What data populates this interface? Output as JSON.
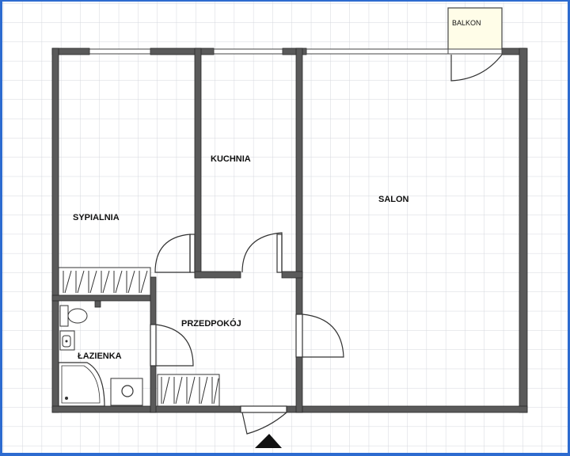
{
  "plan": {
    "rooms": {
      "balkon": "BALKON",
      "kuchnia": "KUCHNIA",
      "salon": "SALON",
      "sypialnia": "SYPIALNIA",
      "przedpokoj": "PRZEDPOKÓJ",
      "lazienka": "ŁAZIENKA"
    },
    "colors": {
      "grid": "#d4d7dd",
      "wall": "#555555",
      "frame": "#2d6bd0"
    },
    "icons": [
      "entrance-arrow-icon",
      "toilet-icon",
      "sink-icon",
      "shower-icon",
      "washing-machine-icon",
      "wardrobe-icon"
    ]
  }
}
